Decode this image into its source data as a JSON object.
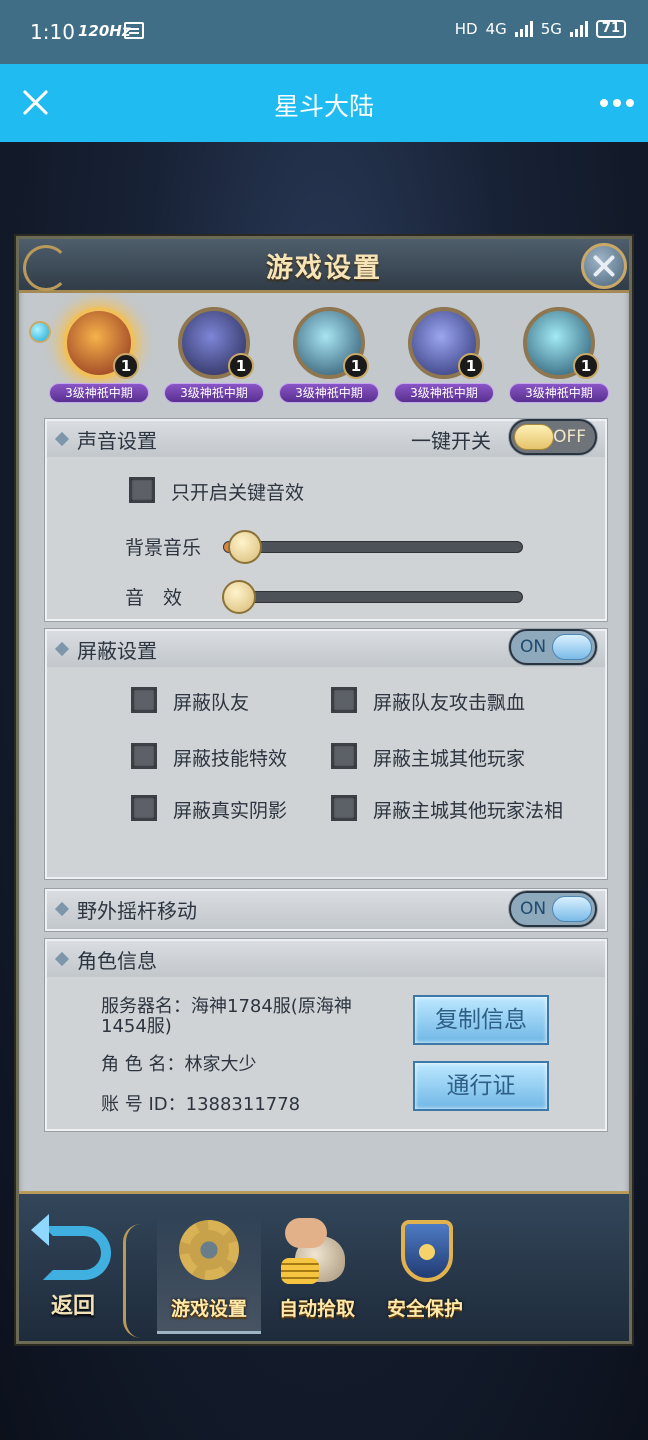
{
  "status_bar": {
    "time": "1:10",
    "refresh_rate": "120Hz",
    "network": "HD",
    "signal_1": "4G",
    "signal_2": "5G",
    "battery": "71"
  },
  "app_bar": {
    "title": "星斗大陆",
    "close_icon": "close-icon",
    "more_icon": "more-dots-icon"
  },
  "panel": {
    "title": "游戏设置"
  },
  "avatars": [
    {
      "label": "3级神祇中期",
      "count": "1",
      "active": true,
      "colors": [
        "#f6b24a",
        "#8a2d1f"
      ]
    },
    {
      "label": "3级神祇中期",
      "count": "1",
      "active": false,
      "colors": [
        "#7d86d8",
        "#24264d"
      ]
    },
    {
      "label": "3级神祇中期",
      "count": "1",
      "active": false,
      "colors": [
        "#a8e4f2",
        "#274e66"
      ]
    },
    {
      "label": "3级神祇中期",
      "count": "1",
      "active": false,
      "colors": [
        "#9ba6f0",
        "#2a2f70"
      ]
    },
    {
      "label": "3级神祇中期",
      "count": "1",
      "active": false,
      "colors": [
        "#a2eaf4",
        "#22506a"
      ]
    }
  ],
  "sound": {
    "title": "声音设置",
    "master_label": "一键开关",
    "master_state": "OFF",
    "key_sound_label": "只开启关键音效",
    "bgm_label": "背景音乐",
    "bgm_level": 0.07,
    "sfx_label": "音　效",
    "sfx_level": 0.05
  },
  "shield": {
    "title": "屏蔽设置",
    "state": "ON",
    "options": [
      "屏蔽队友",
      "屏蔽队友攻击飘血",
      "屏蔽技能特效",
      "屏蔽主城其他玩家",
      "屏蔽真实阴影",
      "屏蔽主城其他玩家法相"
    ]
  },
  "joystick": {
    "title": "野外摇杆移动",
    "state": "ON"
  },
  "role": {
    "title": "角色信息",
    "server_line1": "服务器名：海神1784服(原海神",
    "server_line2": "1454服)",
    "name_line": "角 色 名：林家大少",
    "account_line": "账 号 ID：1388311778",
    "copy_button": "复制信息",
    "pass_button": "通行证"
  },
  "bottom_nav": {
    "back_label": "返回",
    "items": [
      {
        "label": "游戏设置",
        "icon": "gear-icon",
        "active": true
      },
      {
        "label": "自动拾取",
        "icon": "loot-bag-icon",
        "active": false
      },
      {
        "label": "安全保护",
        "icon": "shield-lock-icon",
        "active": false
      }
    ]
  },
  "colors": {
    "app_bar": "#20bbf0",
    "status_bar": "#3f6e86",
    "panel_bg": "#c3c8cc",
    "gold": "#b89a5b",
    "avatar_label": "#7a48b8"
  }
}
